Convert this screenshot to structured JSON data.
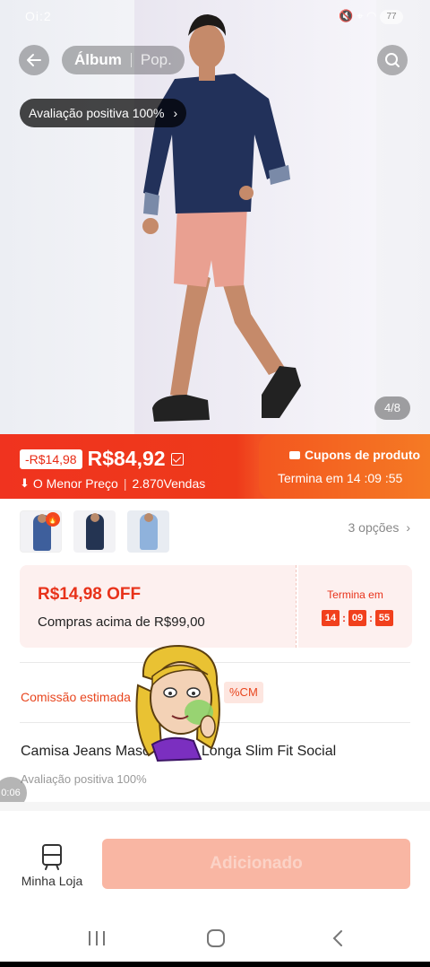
{
  "status_bar": {
    "time": "Oi:2",
    "battery": "77"
  },
  "header": {
    "segments": [
      "Álbum",
      "Pop."
    ],
    "evaluation_pill": "Avaliação positiva 100%"
  },
  "gallery": {
    "counter": "4/8"
  },
  "price": {
    "discount": "-R$14,98",
    "current": "R$84,92",
    "lowest_label": "O Menor Preço",
    "sales": "2.870Vendas"
  },
  "coupon_banner": {
    "title": "Cupons de produto",
    "ends": "Termina em 14 :09 :55"
  },
  "variants": {
    "options_label": "3 opções",
    "thumbs": [
      {
        "color": "#3e5f9c",
        "hot": "🔥"
      },
      {
        "color": "#243452",
        "hot": ""
      },
      {
        "color": "#8fb2dc",
        "hot": ""
      }
    ]
  },
  "coupon_card": {
    "off": "R$14,98 OFF",
    "condition": "Compras acima de R$99,00",
    "ends_label": "Termina em",
    "timer": [
      "14",
      "09",
      "55"
    ]
  },
  "commission": {
    "label": "Comissão estimada",
    "tag": "%CM"
  },
  "product": {
    "title": "Camisa Jeans Masc  Manga Longa Slim Fit Social",
    "evaluation": "Avaliação positiva 100%",
    "video_time": "0:06"
  },
  "bottom": {
    "store_label": "Minha Loja",
    "add_button": "Adicionado"
  },
  "colors": {
    "accent": "#ee3a1a",
    "orange": "#f46a1e",
    "disabled_button": "#f9b6a3"
  }
}
